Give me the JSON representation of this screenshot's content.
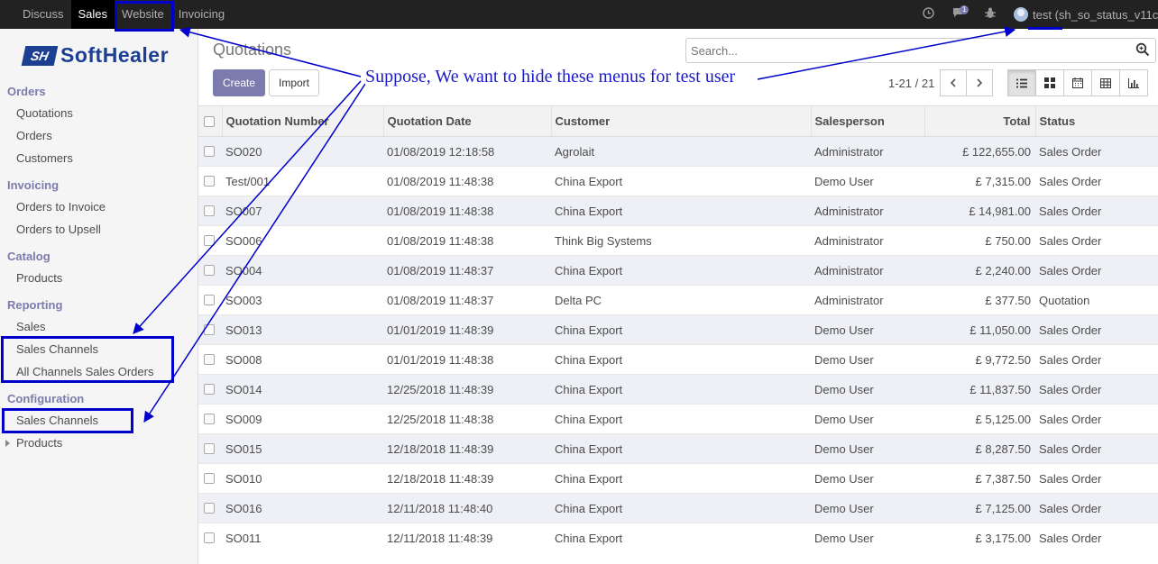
{
  "topbar": {
    "apps": [
      "Discuss",
      "Sales",
      "Website",
      "Invoicing"
    ],
    "active_app": "Sales",
    "chat_badge": "1",
    "user": "test (sh_so_status_v11c"
  },
  "brand": {
    "mark": "SH",
    "name": "SoftHealer"
  },
  "sidebar": {
    "orders": {
      "title": "Orders",
      "items": [
        "Quotations",
        "Orders",
        "Customers"
      ]
    },
    "invoicing": {
      "title": "Invoicing",
      "items": [
        "Orders to Invoice",
        "Orders to Upsell"
      ]
    },
    "catalog": {
      "title": "Catalog",
      "items": [
        "Products"
      ]
    },
    "reporting": {
      "title": "Reporting",
      "items": [
        "Sales",
        "Sales Channels",
        "All Channels Sales Orders"
      ]
    },
    "configuration": {
      "title": "Configuration",
      "items": [
        "Sales Channels",
        "Products"
      ]
    }
  },
  "control": {
    "breadcrumb": "Quotations",
    "create_label": "Create",
    "import_label": "Import",
    "search_placeholder": "Search...",
    "pager": "1-21 / 21"
  },
  "annotation": {
    "text": "Suppose, We want to hide these menus for test user",
    "color": "#0000cc"
  },
  "colors": {
    "brand": "#7c7bad",
    "topbar": "#222222",
    "logo": "#1c3f92"
  },
  "table": {
    "columns": [
      "Quotation Number",
      "Quotation Date",
      "Customer",
      "Salesperson",
      "Total",
      "Status"
    ],
    "rows": [
      [
        "SO020",
        "01/08/2019 12:18:58",
        "Agrolait",
        "Administrator",
        "£ 122,655.00",
        "Sales Order"
      ],
      [
        "Test/001",
        "01/08/2019 11:48:38",
        "China Export",
        "Demo User",
        "£ 7,315.00",
        "Sales Order"
      ],
      [
        "SO007",
        "01/08/2019 11:48:38",
        "China Export",
        "Administrator",
        "£ 14,981.00",
        "Sales Order"
      ],
      [
        "SO006",
        "01/08/2019 11:48:38",
        "Think Big Systems",
        "Administrator",
        "£ 750.00",
        "Sales Order"
      ],
      [
        "SO004",
        "01/08/2019 11:48:37",
        "China Export",
        "Administrator",
        "£ 2,240.00",
        "Sales Order"
      ],
      [
        "SO003",
        "01/08/2019 11:48:37",
        "Delta PC",
        "Administrator",
        "£ 377.50",
        "Quotation"
      ],
      [
        "SO013",
        "01/01/2019 11:48:39",
        "China Export",
        "Demo User",
        "£ 11,050.00",
        "Sales Order"
      ],
      [
        "SO008",
        "01/01/2019 11:48:38",
        "China Export",
        "Demo User",
        "£ 9,772.50",
        "Sales Order"
      ],
      [
        "SO014",
        "12/25/2018 11:48:39",
        "China Export",
        "Demo User",
        "£ 11,837.50",
        "Sales Order"
      ],
      [
        "SO009",
        "12/25/2018 11:48:38",
        "China Export",
        "Demo User",
        "£ 5,125.00",
        "Sales Order"
      ],
      [
        "SO015",
        "12/18/2018 11:48:39",
        "China Export",
        "Demo User",
        "£ 8,287.50",
        "Sales Order"
      ],
      [
        "SO010",
        "12/18/2018 11:48:39",
        "China Export",
        "Demo User",
        "£ 7,387.50",
        "Sales Order"
      ],
      [
        "SO016",
        "12/11/2018 11:48:40",
        "China Export",
        "Demo User",
        "£ 7,125.00",
        "Sales Order"
      ],
      [
        "SO011",
        "12/11/2018 11:48:39",
        "China Export",
        "Demo User",
        "£ 3,175.00",
        "Sales Order"
      ]
    ]
  }
}
